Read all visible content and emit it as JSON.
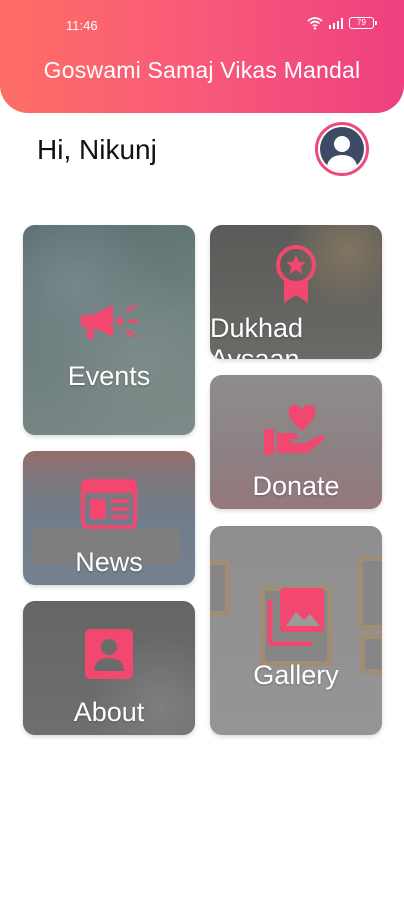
{
  "status_bar": {
    "time": "11:46",
    "battery": "79",
    "icons": [
      "wifi-icon",
      "signal-icon",
      "battery-icon"
    ]
  },
  "header": {
    "title": "Goswami Samaj Vikas Mandal",
    "gradient": [
      "#ff6e66",
      "#ee3f80"
    ]
  },
  "greeting": "Hi, Nikunj",
  "avatar": {
    "icon": "user-avatar-icon"
  },
  "accent_color": "#f2476f",
  "tiles": {
    "events": {
      "label": "Events",
      "icon": "megaphone-icon"
    },
    "dukhad": {
      "label": "Dukhad Avsaan",
      "icon": "badge-star-icon"
    },
    "donate": {
      "label": "Donate",
      "icon": "hand-heart-icon"
    },
    "news": {
      "label": "News",
      "icon": "newspaper-icon"
    },
    "about": {
      "label": "About",
      "icon": "contact-card-icon"
    },
    "gallery": {
      "label": "Gallery",
      "icon": "photo-gallery-icon"
    }
  }
}
